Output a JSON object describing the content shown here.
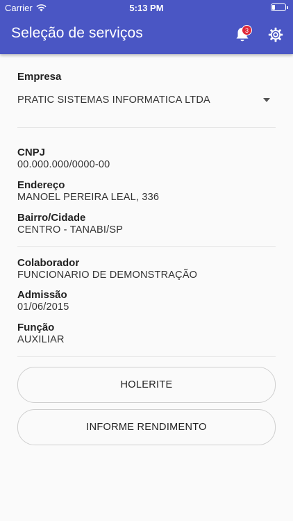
{
  "status_bar": {
    "carrier": "Carrier",
    "time": "5:13 PM"
  },
  "header": {
    "title": "Seleção de serviços",
    "notification_count": "3"
  },
  "empresa": {
    "label": "Empresa",
    "selected": "PRATIC SISTEMAS INFORMATICA LTDA"
  },
  "details": {
    "cnpj_label": "CNPJ",
    "cnpj_value": "00.000.000/0000-00",
    "endereco_label": "Endereço",
    "endereco_value": "MANOEL PEREIRA LEAL, 336",
    "bairro_label": "Bairro/Cidade",
    "bairro_value": "CENTRO - TANABI/SP"
  },
  "colaborador": {
    "label": "Colaborador",
    "value": "FUNCIONARIO DE DEMONSTRAÇÃO",
    "admissao_label": "Admissão",
    "admissao_value": "01/06/2015",
    "funcao_label": "Função",
    "funcao_value": "AUXILIAR"
  },
  "buttons": {
    "holerite": "HOLERITE",
    "informe": "INFORME RENDIMENTO"
  },
  "colors": {
    "header": "#4a56c4",
    "badge": "#e0283a",
    "background": "#fafafa"
  },
  "icons": [
    "wifi-icon",
    "battery-icon",
    "bell-icon",
    "gear-icon",
    "dropdown-caret-icon"
  ]
}
